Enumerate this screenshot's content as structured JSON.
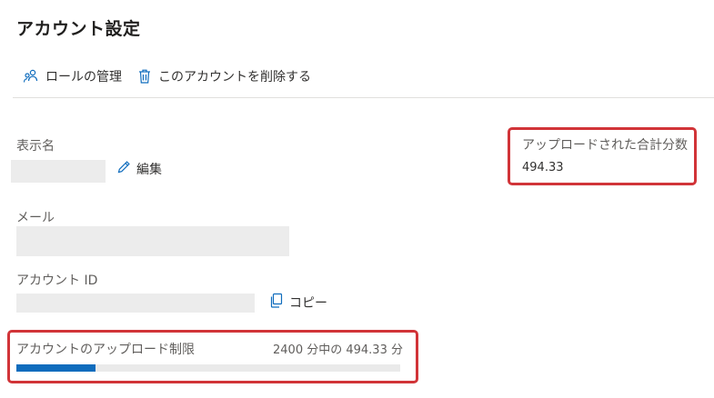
{
  "page": {
    "title": "アカウント設定"
  },
  "toolbar": {
    "manage_roles_label": "ロールの管理",
    "delete_account_label": "このアカウントを削除する"
  },
  "display_name": {
    "label": "表示名",
    "edit_label": "編集"
  },
  "email": {
    "label": "メール"
  },
  "account_id": {
    "label": "アカウント ID",
    "copy_label": "コピー"
  },
  "total_uploaded": {
    "label": "アップロードされた合計分数",
    "value": "494.33"
  },
  "upload_limit": {
    "label": "アカウントのアップロード制限",
    "summary": "2400 分中の 494.33 分",
    "used": 494.33,
    "limit": 2400
  },
  "colors": {
    "accent": "#0f6cbd",
    "highlight_box": "#d13438"
  },
  "icons": [
    "people-icon",
    "trash-icon",
    "pencil-icon",
    "copy-icon"
  ]
}
